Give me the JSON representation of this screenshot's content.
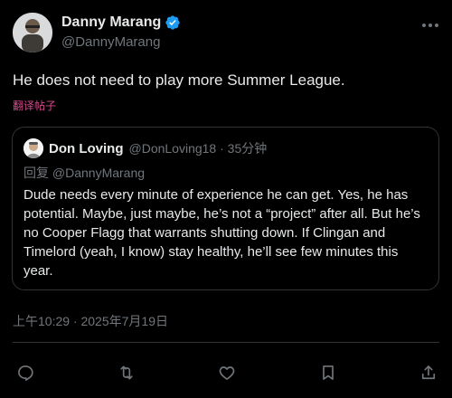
{
  "author": {
    "name": "Danny Marang",
    "handle": "@DannyMarang",
    "verified": true,
    "verified_color": "#1d9bf0"
  },
  "post": {
    "text": "He does not need to play more Summer League.",
    "translate_label": "翻译帖子"
  },
  "quoted": {
    "name": "Don Loving",
    "meta": "@DonLoving18 · 35分钟",
    "reply_to": "回复 @DannyMarang",
    "text": "Dude needs every minute of experience he can get. Yes, he has potential. Maybe, just maybe, he’s not a “project” after all. But he’s no Cooper Flagg that warrants shutting down. If Clingan and Timelord (yeah, I know) stay healthy, he’ll see few minutes this year."
  },
  "timestamp": "上午10:29 · 2025年7月19日",
  "actions": [
    {
      "name": "reply",
      "icon": "reply-icon"
    },
    {
      "name": "repost",
      "icon": "repost-icon"
    },
    {
      "name": "like",
      "icon": "like-icon"
    },
    {
      "name": "bookmark",
      "icon": "bookmark-icon"
    },
    {
      "name": "share",
      "icon": "share-icon"
    }
  ]
}
